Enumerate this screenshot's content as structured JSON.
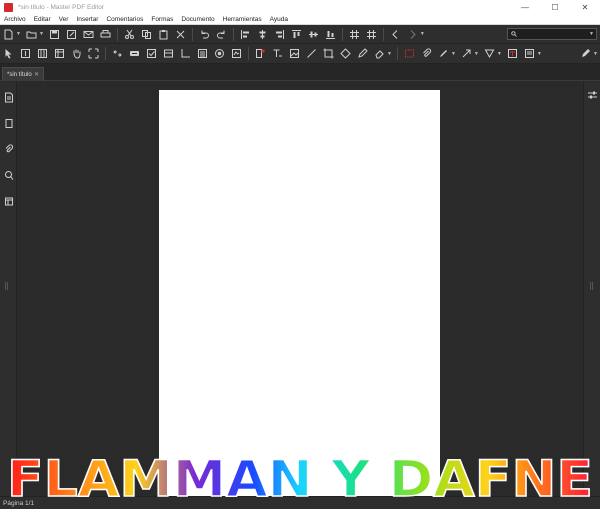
{
  "window": {
    "title": "*sin título - Master PDF Editor",
    "minimize": "—",
    "maximize": "☐",
    "close": "✕"
  },
  "menu": [
    "Archivo",
    "Editar",
    "Ver",
    "Insertar",
    "Comentarios",
    "Formas",
    "Documento",
    "Herramientas",
    "Ayuda"
  ],
  "search": {
    "value": "",
    "placeholder": ""
  },
  "tab": {
    "label": "*sin título",
    "close": "✕"
  },
  "status": {
    "text": "Página 1/1"
  },
  "watermark": {
    "text": "FLAMMAN Y DAFNE"
  },
  "colors": {
    "accent": "#d42a2a",
    "icon": "#d0d0d0",
    "page": "#ffffff",
    "workspace": "#2a2a2a"
  }
}
